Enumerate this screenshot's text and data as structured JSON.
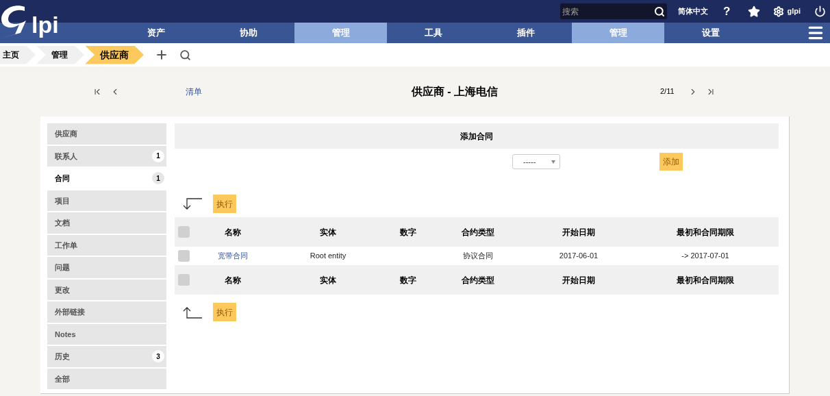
{
  "logo": {
    "text": "lpi"
  },
  "top_bar": {
    "search": {
      "placeholder": "搜索"
    },
    "language": "简体中文",
    "help": "?",
    "user": "glpi"
  },
  "menu": [
    {
      "label": "资产",
      "selected": false
    },
    {
      "label": "协助",
      "selected": false
    },
    {
      "label": "管理",
      "selected": true
    },
    {
      "label": "工具",
      "selected": false
    },
    {
      "label": "插件",
      "selected": false
    },
    {
      "label": "管理",
      "selected": true
    },
    {
      "label": "设置",
      "selected": false
    }
  ],
  "breadcrumbs": [
    {
      "label": "主页",
      "selected": false
    },
    {
      "label": "管理",
      "selected": false
    },
    {
      "label": "供应商",
      "selected": true
    }
  ],
  "record_nav": {
    "list_link": "清单",
    "title": "供应商 - 上海电信",
    "position": "2/11"
  },
  "sidebar": [
    {
      "label": "供应商",
      "selected": false
    },
    {
      "label": "联系人",
      "count": "1",
      "selected": false
    },
    {
      "label": "合同",
      "count": "1",
      "selected": true
    },
    {
      "label": "项目",
      "selected": false
    },
    {
      "label": "文档",
      "selected": false
    },
    {
      "label": "工作单",
      "selected": false
    },
    {
      "label": "问题",
      "selected": false
    },
    {
      "label": "更改",
      "selected": false
    },
    {
      "label": "外部链接",
      "selected": false
    },
    {
      "label": "Notes",
      "selected": false
    },
    {
      "label": "历史",
      "count": "3",
      "selected": false
    },
    {
      "label": "全部",
      "selected": false
    }
  ],
  "add_contract": {
    "title": "添加合同",
    "dropdown": {
      "value": "-----"
    },
    "button": "添加"
  },
  "actions_top": {
    "button": "执行"
  },
  "table": {
    "columns": [
      "名称",
      "实体",
      "数字",
      "合约类型",
      "开始日期",
      "最初和合同期限"
    ],
    "header_checked": false,
    "rows": [
      {
        "checked": false,
        "cells": [
          "宽带合同",
          "Root entity",
          "",
          "协议合同",
          "2017-06-01",
          "-> 2017-07-01"
        ]
      }
    ],
    "footer_columns": [
      "名称",
      "实体",
      "数字",
      "合约类型",
      "开始日期",
      "最初和合同期限"
    ],
    "footer_checked": false
  },
  "actions_bottom": {
    "button": "执行"
  }
}
